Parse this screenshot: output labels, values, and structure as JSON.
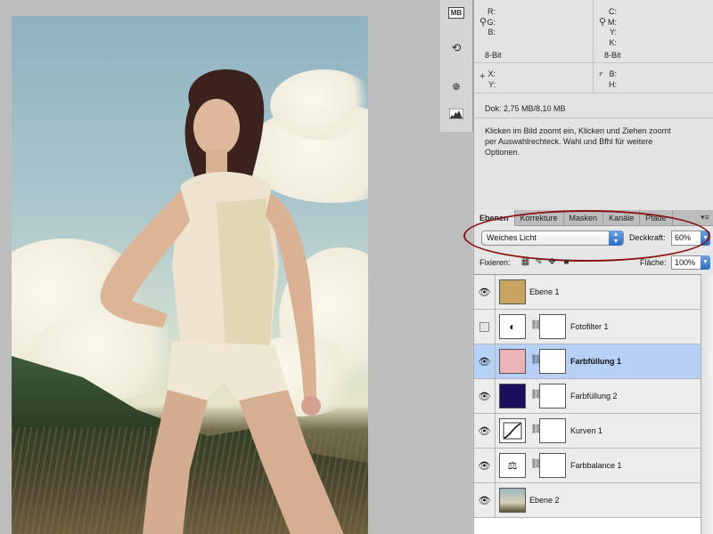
{
  "info_panel": {
    "rgb_labels": [
      "R:",
      "G:",
      "B:"
    ],
    "cmyk_labels": [
      "C:",
      "M:",
      "Y:",
      "K:"
    ],
    "bit_left": "8-Bit",
    "bit_right": "8-Bit",
    "xy_labels": [
      "X:",
      "Y:"
    ],
    "bh_labels": [
      "B:",
      "H:"
    ],
    "doc": "Dok: 2,75 MB/8,10 MB",
    "hint_line1": "Klicken im Bild zoomt ein, Klicken und Ziehen zoomt",
    "hint_line2": "per Auswahlrechteck. Wahl und Bfhl für weitere",
    "hint_line3": "Optionen."
  },
  "tool_strip": {
    "icons": [
      "mb-icon",
      "history-icon",
      "navigator-icon",
      "histogram-icon"
    ],
    "mb_label": "MB"
  },
  "layers_panel": {
    "tabs": [
      "Ebenen",
      "Korrekture",
      "Masken",
      "Kanäle",
      "Pfade"
    ],
    "active_tab": "Ebenen",
    "blend_mode": "Weiches Licht",
    "opacity_label": "Deckkraft:",
    "opacity_value": "60%",
    "lock_label": "Fixieren:",
    "fill_label": "Fläche:",
    "fill_value": "100%",
    "highlight_color": "#8a1313",
    "selection_color": "#b7d1f6",
    "layers": [
      {
        "name": "Ebene 1",
        "visible": true,
        "type": "pixel",
        "thumb_color": "#c9a461"
      },
      {
        "name": "Fotofilter 1",
        "visible": false,
        "type": "adjustment",
        "icon": "photo-filter-icon"
      },
      {
        "name": "Farbfüllung 1",
        "visible": true,
        "type": "fill",
        "thumb_color": "#eab3b5",
        "selected": true
      },
      {
        "name": "Farbfüllung 2",
        "visible": true,
        "type": "fill",
        "thumb_color": "#1a0f5c"
      },
      {
        "name": "Kurven 1",
        "visible": true,
        "type": "adjustment",
        "icon": "curves-icon"
      },
      {
        "name": "Farbbalance 1",
        "visible": true,
        "type": "adjustment",
        "icon": "color-balance-icon"
      },
      {
        "name": "Ebene 2",
        "visible": true,
        "type": "pixel",
        "thumb_color": "#8a9f93"
      }
    ]
  }
}
